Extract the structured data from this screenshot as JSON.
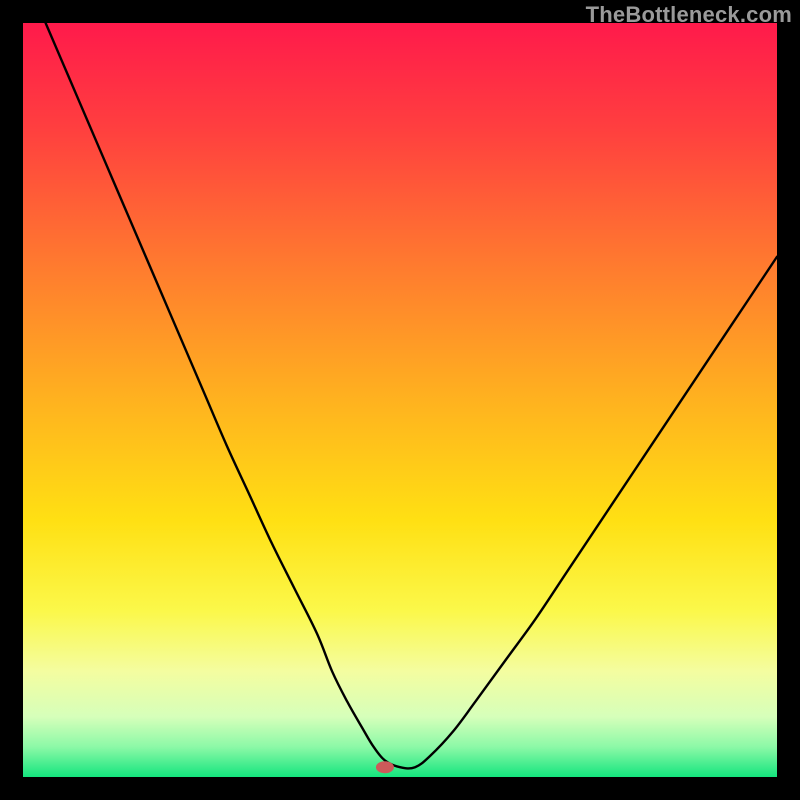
{
  "watermark": "TheBottleneck.com",
  "chart_data": {
    "type": "line",
    "title": "",
    "xlabel": "",
    "ylabel": "",
    "xlim": [
      0,
      100
    ],
    "ylim": [
      0,
      100
    ],
    "grid": false,
    "legend": false,
    "gradient_stops": [
      {
        "pct": 0,
        "color": "#ff1a4b"
      },
      {
        "pct": 14,
        "color": "#ff3f3f"
      },
      {
        "pct": 32,
        "color": "#ff7a2f"
      },
      {
        "pct": 50,
        "color": "#ffb21f"
      },
      {
        "pct": 66,
        "color": "#ffe013"
      },
      {
        "pct": 78,
        "color": "#fbf84a"
      },
      {
        "pct": 86,
        "color": "#f4fda0"
      },
      {
        "pct": 92,
        "color": "#d6ffba"
      },
      {
        "pct": 96,
        "color": "#8cf9a7"
      },
      {
        "pct": 100,
        "color": "#14e57e"
      }
    ],
    "series": [
      {
        "name": "bottleneck-curve",
        "x": [
          3,
          6,
          9,
          12,
          15,
          18,
          21,
          24,
          27,
          30,
          33,
          36,
          39,
          41,
          43,
          45,
          46.5,
          48,
          50,
          52,
          54,
          57,
          60,
          64,
          68,
          72,
          76,
          80,
          84,
          88,
          92,
          96,
          100
        ],
        "y": [
          100,
          93,
          86,
          79,
          72,
          65,
          58,
          51,
          44,
          37.5,
          31,
          25,
          19,
          14,
          10,
          6.5,
          4,
          2.2,
          1.3,
          1.3,
          2.8,
          6,
          10,
          15.5,
          21,
          27,
          33,
          39,
          45,
          51,
          57,
          63,
          69
        ]
      }
    ],
    "marker": {
      "x": 48,
      "y": 1.3,
      "color": "#cc5a5a",
      "rx": 9,
      "ry": 6
    },
    "line_color": "#000000",
    "line_width": 2.4
  }
}
